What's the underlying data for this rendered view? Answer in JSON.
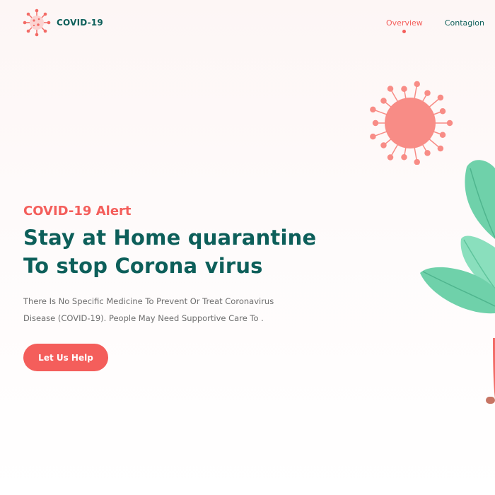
{
  "brand": {
    "name": "COVID-19"
  },
  "nav": {
    "items": [
      {
        "label": "Overview"
      },
      {
        "label": "Contagion"
      }
    ]
  },
  "hero": {
    "alert": "COVID-19 Alert",
    "title_line1": "Stay at Home quarantine",
    "title_line2": "To stop Corona virus",
    "desc_line1": "There Is No Specific Medicine To Prevent Or Treat Coronavirus",
    "desc_line2": "Disease (COVID-19). People May Need Supportive Care To .",
    "cta": "Let Us Help"
  },
  "colors": {
    "accent": "#f45e5b",
    "primary": "#0d5f5a",
    "virus": "#f88c86",
    "leaf": "#6fd1aa",
    "text": "#6d6d6d"
  },
  "icons": {
    "logo": "virus-logo-icon",
    "decoration_virus": "virus-illustration",
    "decoration_plant": "plant-illustration"
  }
}
